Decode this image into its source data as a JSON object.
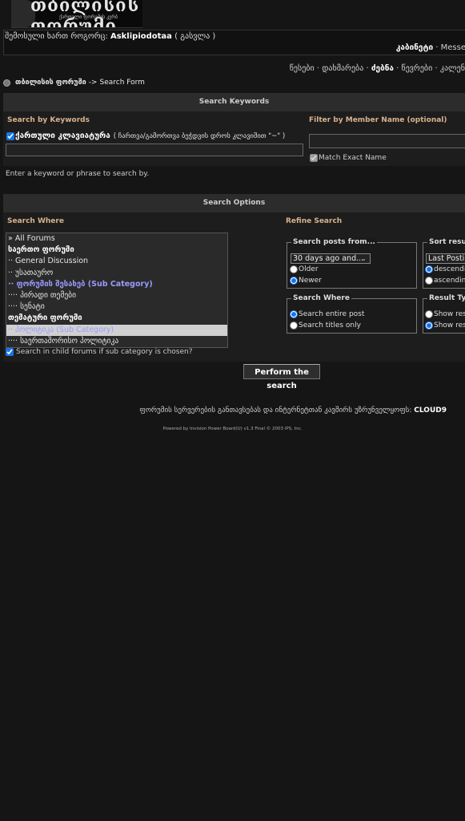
{
  "header": {
    "logo_text": "თბილისის ფორუმი",
    "logo_subtext": "ქართული ფორუმის კვრბ"
  },
  "userbar": {
    "logged_in_as": "შემოსული ხართ როგორც:",
    "username": "Asklipiodotaa",
    "logout": "( გასვლა )",
    "cabinet": "კაბინეტი",
    "separator": "·",
    "messenger": "Messe"
  },
  "nav": {
    "rules": "წესები",
    "help": "დახმარება",
    "search": "ძებნა",
    "members": "წევრები",
    "calendar": "კალენ"
  },
  "breadcrumb": {
    "forum": "თბილისის ფორუმი",
    "arrow": "->",
    "page": "Search Form"
  },
  "keywords_section": {
    "bar_title": "Search Keywords",
    "by_keywords": "Search by Keywords",
    "by_member": "Filter by Member Name (optional)",
    "georgian_keyboard_label": "ქართული კლავიატურა",
    "georgian_keyboard_hint": "( ჩართვა/გამორთვა ბეჭდვის დროს კლავიშით \"~\" )",
    "keyword_value": "",
    "member_value": "",
    "match_exact": "Match Exact Name",
    "hint": "Enter a keyword or phrase to search by."
  },
  "options_section": {
    "bar_title": "Search Options",
    "search_where": "Search Where",
    "refine_search": "Refine Search",
    "forums": [
      {
        "label": "» All Forums",
        "style": "normal"
      },
      {
        "label": "საერთო ფორუმი",
        "style": "bold"
      },
      {
        "label": "·· General Discussion",
        "style": "normal"
      },
      {
        "label": "·· უსათაურო",
        "style": "normal"
      },
      {
        "label": "·· ფორუმის შესახებ (Sub Category)",
        "style": "sub"
      },
      {
        "label": "···· პირადი თემები",
        "style": "normal"
      },
      {
        "label": "···· სენატი",
        "style": "normal"
      },
      {
        "label": "თემატური ფორუმი",
        "style": "bold"
      },
      {
        "label": "·· პოლიტიკა (Sub Category)",
        "style": "sel"
      },
      {
        "label": "···· საერთაშორისო პოლიტიკა",
        "style": "normal"
      }
    ],
    "child_forums": "Search in child forums if sub category is chosen?",
    "posts_from": {
      "legend": "Search posts from...",
      "selected": "30 days ago and...",
      "older": "Older",
      "newer": "Newer"
    },
    "sort_results": {
      "legend": "Sort results",
      "selected": "Last Postin",
      "descending": "descendin",
      "ascending": "ascending"
    },
    "where": {
      "legend": "Search Where",
      "entire": "Search entire post",
      "titles": "Search titles only"
    },
    "result_type": {
      "legend": "Result Type",
      "show_results_posts": "Show resu",
      "show_results_topics": "Show resu"
    },
    "perform": "Perform the search"
  },
  "footer": {
    "hosting_text": "ფორუმის სერვერების განთავსებას და ინტერნეტთან კავშირს უზრუნველყოფს:",
    "hosting_brand": "CLOUD9",
    "powered": "Powered by Invision Power Board(U) v1.3 Final © 2003  IPS, Inc."
  }
}
